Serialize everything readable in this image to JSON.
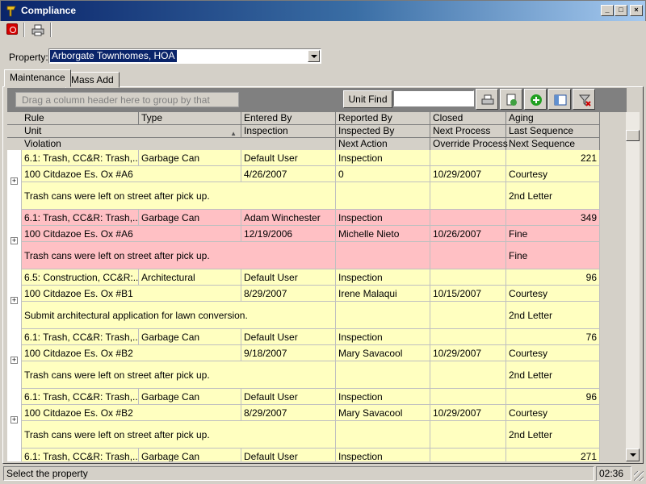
{
  "window": {
    "title": "Compliance"
  },
  "property": {
    "label": "Property:",
    "value": "Arborgate Townhomes, HOA"
  },
  "tabs": [
    {
      "label": "Maintenance"
    },
    {
      "label": "Mass Add"
    }
  ],
  "group_bar": {
    "hint": "Drag a column header here to group by that column.",
    "unit_find_label": "Unit Find",
    "unit_find_value": ""
  },
  "headers": {
    "row1": [
      "Rule",
      "Type",
      "Entered By",
      "Reported By",
      "Closed",
      "Aging"
    ],
    "row2": [
      "Unit",
      "Inspection",
      "Inspected By",
      "Next Process",
      "Last Sequence"
    ],
    "row3": [
      "Violation",
      "Next Action",
      "Override Process",
      "Next Sequence"
    ]
  },
  "records": [
    {
      "rule": "6.1: Trash, CC&R: Trash,...",
      "type": "Garbage Can",
      "entered_by": "Default User",
      "reported_by": "Inspection",
      "aging": "221",
      "unit": "100 Citdazoe Es. Ox #A6",
      "inspection": "4/26/2007",
      "inspected_by": "0",
      "next_process": "10/29/2007",
      "last_sequence": "Courtesy",
      "violation": "Trash cans were left on street after pick up.",
      "next_sequence": "2nd Letter"
    },
    {
      "rule": "6.1: Trash, CC&R: Trash,...",
      "type": "Garbage Can",
      "entered_by": "Adam Winchester",
      "reported_by": "Inspection",
      "aging": "349",
      "unit": "100 Citdazoe Es. Ox #A6",
      "inspection": "12/19/2006",
      "inspected_by": "Michelle Nieto",
      "next_process": "10/26/2007",
      "last_sequence": "Fine",
      "violation": "Trash cans were left on street after pick up.",
      "next_sequence": "Fine"
    },
    {
      "rule": "6.5: Construction, CC&R:...",
      "type": "Architectural",
      "entered_by": "Default User",
      "reported_by": "Inspection",
      "aging": "96",
      "unit": "100 Citdazoe Es. Ox #B1",
      "inspection": "8/29/2007",
      "inspected_by": "Irene Malaqui",
      "next_process": "10/15/2007",
      "last_sequence": "Courtesy",
      "violation": "Submit architectural application for lawn conversion.",
      "next_sequence": "2nd Letter"
    },
    {
      "rule": "6.1: Trash, CC&R: Trash,...",
      "type": "Garbage Can",
      "entered_by": "Default User",
      "reported_by": "Inspection",
      "aging": "76",
      "unit": "100 Citdazoe Es. Ox #B2",
      "inspection": "9/18/2007",
      "inspected_by": "Mary Savacool",
      "next_process": "10/29/2007",
      "last_sequence": "Courtesy",
      "violation": "Trash cans were left on street after pick up.",
      "next_sequence": "2nd Letter"
    },
    {
      "rule": "6.1: Trash, CC&R: Trash,...",
      "type": "Garbage Can",
      "entered_by": "Default User",
      "reported_by": "Inspection",
      "aging": "96",
      "unit": "100 Citdazoe Es. Ox #B2",
      "inspection": "8/29/2007",
      "inspected_by": "Mary Savacool",
      "next_process": "10/29/2007",
      "last_sequence": "Courtesy",
      "violation": "Trash cans were left on street after pick up.",
      "next_sequence": "2nd Letter"
    },
    {
      "rule": "6.1: Trash, CC&R: Trash,...",
      "type": "Garbage Can",
      "entered_by": "Default User",
      "reported_by": "Inspection",
      "aging": "271",
      "unit": "",
      "inspection": "",
      "inspected_by": "",
      "next_process": "",
      "last_sequence": "",
      "violation": "",
      "next_sequence": ""
    }
  ],
  "status": {
    "message": "Select the property",
    "time": "02:36"
  },
  "colors": {
    "row_normal": "#ffffc0",
    "row_highlight": "#ffc0c4",
    "title_bar": "#0a246a"
  }
}
